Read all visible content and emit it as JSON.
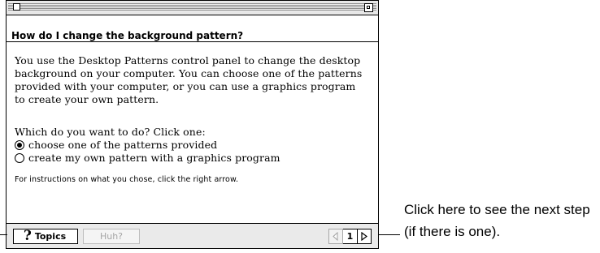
{
  "window": {
    "question": "How do I change the background pattern?",
    "paragraph": "You use the Desktop Patterns control panel to change the desktop background on your computer. You can choose one of the patterns provided with your computer, or you can use a graphics program to create your own pattern.",
    "prompt": "Which do you want to do? Click one:",
    "options": [
      {
        "label": "choose one of the patterns provided",
        "selected": true
      },
      {
        "label": "create my own pattern with a graphics program",
        "selected": false
      }
    ],
    "instructions": "For instructions on what you chose, click the right arrow.",
    "bottom_bar": {
      "topics_icon": "?",
      "topics_label": "Topics",
      "huh_label": "Huh?",
      "page_number": "1",
      "prev_arrow_icon": "left-arrow-icon",
      "next_arrow_icon": "right-arrow-icon"
    }
  },
  "callout": {
    "text": "Click here to see the next step (if there is one)."
  }
}
